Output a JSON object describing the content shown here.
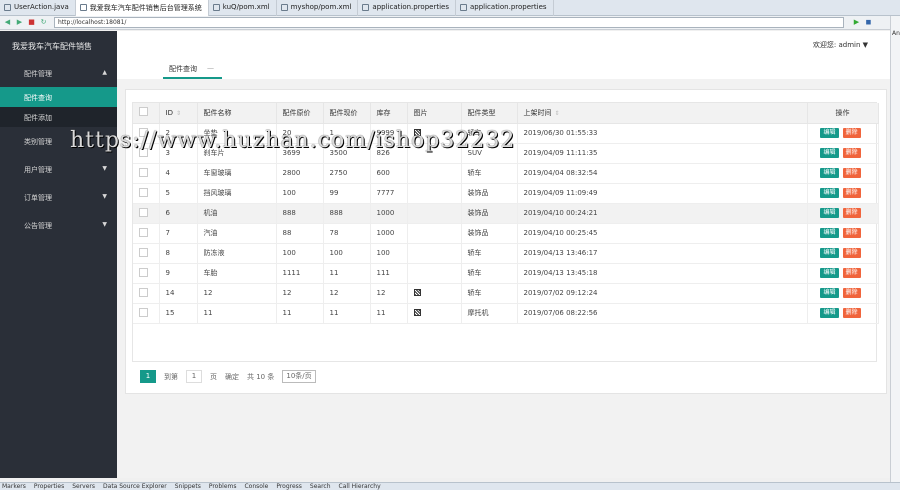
{
  "editor_tabs": [
    "UserAction.java",
    "我爱我车汽车配件销售后台管理系统",
    "kuQ/pom.xml",
    "myshop/pom.xml",
    "application.properties",
    "application.properties"
  ],
  "browser": {
    "url": "http://localhost:18081/"
  },
  "right_rail_label": "An",
  "sidebar": {
    "brand": "我爱我车汽车配件销售",
    "menu": [
      {
        "label": "配件管理",
        "arrow": "▲"
      },
      {
        "label": "用户管理",
        "arrow": "▼"
      },
      {
        "label": "订单管理",
        "arrow": "▼"
      },
      {
        "label": "公告管理",
        "arrow": "▼"
      }
    ],
    "sub_items": [
      "配件查询",
      "配件添加"
    ],
    "hidden_item": "类别管理"
  },
  "header": {
    "user_label": "欢迎您: admin ▼"
  },
  "page_tab": {
    "label": "配件查询",
    "close": "—"
  },
  "table": {
    "headers": [
      "ID",
      "配件名称",
      "配件原价",
      "配件现价",
      "库存",
      "图片",
      "配件类型",
      "上架时间",
      "操作"
    ],
    "rows": [
      {
        "id": "2",
        "name": "坐垫",
        "orig": "20",
        "cur": "1",
        "stock": "9999",
        "pic": true,
        "type": "轿车",
        "time": "2019/06/30 01:55:33"
      },
      {
        "id": "3",
        "name": "刹车片",
        "orig": "3699",
        "cur": "3500",
        "stock": "826",
        "pic": false,
        "type": "SUV",
        "time": "2019/04/09 11:11:35"
      },
      {
        "id": "4",
        "name": "车窗玻璃",
        "orig": "2800",
        "cur": "2750",
        "stock": "600",
        "pic": false,
        "type": "轿车",
        "time": "2019/04/04 08:32:54"
      },
      {
        "id": "5",
        "name": "挡风玻璃",
        "orig": "100",
        "cur": "99",
        "stock": "7777",
        "pic": false,
        "type": "装饰品",
        "time": "2019/04/09 11:09:49"
      },
      {
        "id": "6",
        "name": "机油",
        "orig": "888",
        "cur": "888",
        "stock": "1000",
        "pic": false,
        "type": "装饰品",
        "time": "2019/04/10 00:24:21"
      },
      {
        "id": "7",
        "name": "汽油",
        "orig": "88",
        "cur": "78",
        "stock": "1000",
        "pic": false,
        "type": "装饰品",
        "time": "2019/04/10 00:25:45"
      },
      {
        "id": "8",
        "name": "防冻液",
        "orig": "100",
        "cur": "100",
        "stock": "100",
        "pic": false,
        "type": "轿车",
        "time": "2019/04/13 13:46:17"
      },
      {
        "id": "9",
        "name": "车胎",
        "orig": "1111",
        "cur": "11",
        "stock": "111",
        "pic": false,
        "type": "轿车",
        "time": "2019/04/13 13:45:18"
      },
      {
        "id": "14",
        "name": "12",
        "orig": "12",
        "cur": "12",
        "stock": "12",
        "pic": true,
        "type": "轿车",
        "time": "2019/07/02 09:12:24"
      },
      {
        "id": "15",
        "name": "11",
        "orig": "11",
        "cur": "11",
        "stock": "11",
        "pic": true,
        "type": "摩托机",
        "time": "2019/07/06 08:22:56"
      }
    ],
    "edit_label": "编辑",
    "delete_label": "删除"
  },
  "pager": {
    "current": "1",
    "goto": "到第",
    "page_input": "1",
    "page_unit": "页",
    "confirm": "确定",
    "total": "共 10 条",
    "page_size": "10条/页"
  },
  "watermark": "https://www.huzhan.com/ishop32232",
  "bottom_tabs": [
    "Markers",
    "Properties",
    "Servers",
    "Data Source Explorer",
    "Snippets",
    "Problems",
    "Console",
    "Progress",
    "Search",
    "Call Hierarchy"
  ]
}
